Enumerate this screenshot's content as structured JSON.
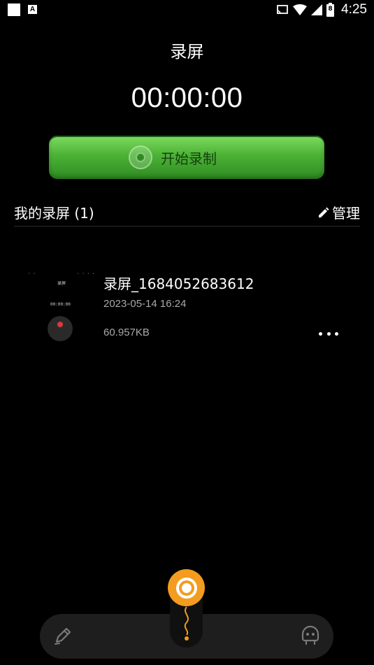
{
  "status_bar": {
    "time": "4:25",
    "battery_level": "8",
    "icons": [
      "notification-square-icon",
      "notification-a-icon",
      "cast-icon",
      "wifi-icon",
      "signal-icon",
      "battery-icon"
    ]
  },
  "header": {
    "title": "录屏"
  },
  "timer": {
    "value": "00:00:00"
  },
  "start_button": {
    "label": "开始录制",
    "icon": "record-target-icon"
  },
  "recordings": {
    "title": "我的录屏 (1)",
    "manage_label": "管理",
    "manage_icon": "pencil-icon",
    "items": [
      {
        "name": "录屏_1684052683612",
        "date": "2023-05-14 16:24",
        "size": "60.957KB",
        "more_icon": "more-dots-icon"
      }
    ]
  },
  "bottom_nav": {
    "left_icon": "edit-brush-icon",
    "center_icon": "record-fab-icon",
    "right_icon": "robot-face-icon",
    "colors": {
      "fab": "#f39c1f",
      "nav_bg": "#1e1e1e"
    }
  },
  "colors": {
    "background": "#000000",
    "start_button_green": "#4cb236",
    "start_label": "#163f10",
    "secondary_text": "#a8a8a8"
  }
}
